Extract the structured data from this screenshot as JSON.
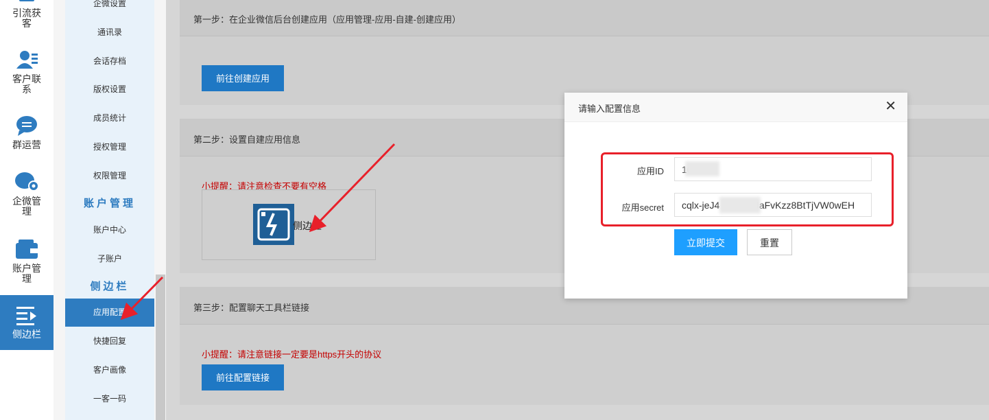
{
  "rail": {
    "items": [
      {
        "label": "引流获客",
        "icon": "funnel-icon"
      },
      {
        "label": "客户联系",
        "icon": "contacts-icon"
      },
      {
        "label": "群运营",
        "icon": "chat-group-icon"
      },
      {
        "label": "企微管理",
        "icon": "wecom-settings-icon"
      },
      {
        "label": "账户管理",
        "icon": "wallet-icon"
      },
      {
        "label": "侧边栏",
        "icon": "sidebar-menu-icon",
        "active": true
      }
    ]
  },
  "submenu": {
    "items_top": [
      "企微设置",
      "通讯录",
      "会话存档",
      "版权设置",
      "成员统计",
      "授权管理",
      "权限管理"
    ],
    "section_account": "账户管理",
    "items_account": [
      "账户中心",
      "子账户"
    ],
    "section_sidebar": "侧边栏",
    "items_sidebar": [
      "应用配置",
      "快捷回复",
      "客户画像",
      "一客一码"
    ],
    "active": "应用配置"
  },
  "main": {
    "step1": {
      "title": "第一步：在企业微信后台创建应用（应用管理-应用-自建-创建应用）",
      "button": "前往创建应用"
    },
    "step2": {
      "title": "第二步：设置自建应用信息",
      "tip": "小提醒：请注意检查不要有空格",
      "image_label": "侧边栏"
    },
    "step3": {
      "title": "第三步：配置聊天工具栏链接",
      "tip": "小提醒：请注意链接一定要是https开头的协议",
      "button": "前往配置链接"
    }
  },
  "modal": {
    "title": "请输入配置信息",
    "close_icon": "close-icon",
    "fields": [
      {
        "label": "应用ID",
        "value": "10"
      },
      {
        "label": "应用secret",
        "value": "cqlx-jeJ4        v3uIaFvKzz8BtTjVW0wEH"
      }
    ],
    "submit": "立即提交",
    "reset": "重置"
  },
  "colors": {
    "primary": "#1f78c4",
    "submit": "#1e9fff",
    "highlight": "#e8202a",
    "tip": "#c40000",
    "rail_active": "#2e7cc0"
  }
}
